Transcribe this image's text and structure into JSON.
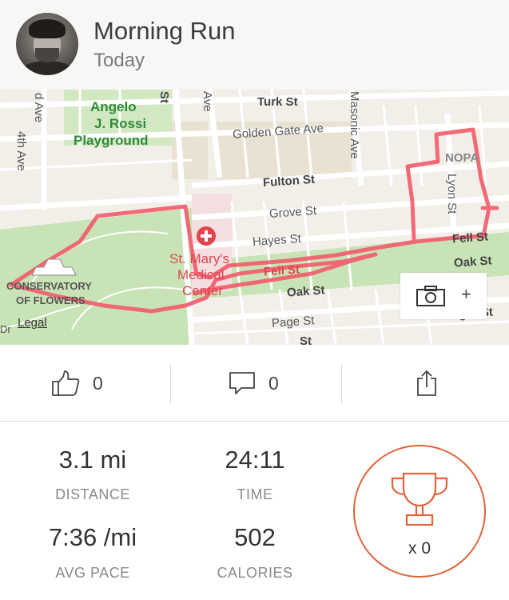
{
  "activity": {
    "title": "Morning Run",
    "date": "Today"
  },
  "map": {
    "streets": {
      "turk": "Turk St",
      "golden_gate": "Golden Gate Ave",
      "fulton": "Fulton St",
      "grove": "Grove St",
      "hayes": "Hayes St",
      "fell_left": "Fell St",
      "fell_right": "Fell St",
      "oak_center": "Oak St",
      "oak_right": "Oak St",
      "page": "Page St",
      "haight": "Haight St",
      "st": "St",
      "ave": "Ave",
      "masonic": "Masonic Ave",
      "lyon": "Lyon St",
      "fourth_ave": "4th Ave",
      "d_ave": "d Ave",
      "dr": "Dr",
      "nopa": "NOPA",
      "st_partial": "St"
    },
    "places": {
      "playground": "Angelo J. Rossi Playground",
      "playground_line1": "Angelo",
      "playground_line2": "J. Rossi",
      "playground_line3": "Playground",
      "hospital_line1": "St. Mary's",
      "hospital_line2": "Medical",
      "hospital_line3": "Center",
      "conservatory_line1": "CONSERVATORY",
      "conservatory_line2": "OF FLOWERS"
    },
    "legal": "Legal",
    "add_photo_plus": "+",
    "route_color": "#f25a6a"
  },
  "actions": {
    "kudos_count": "0",
    "comments_count": "0"
  },
  "stats": {
    "distance_value": "3.1 mi",
    "distance_label": "DISTANCE",
    "time_value": "24:11",
    "time_label": "TIME",
    "pace_value": "7:36 /mi",
    "pace_label": "AVG PACE",
    "calories_value": "502",
    "calories_label": "CALORIES",
    "achievements_count": "x 0"
  },
  "colors": {
    "accent": "#e0633a",
    "header_bg": "#f7f7f5"
  }
}
